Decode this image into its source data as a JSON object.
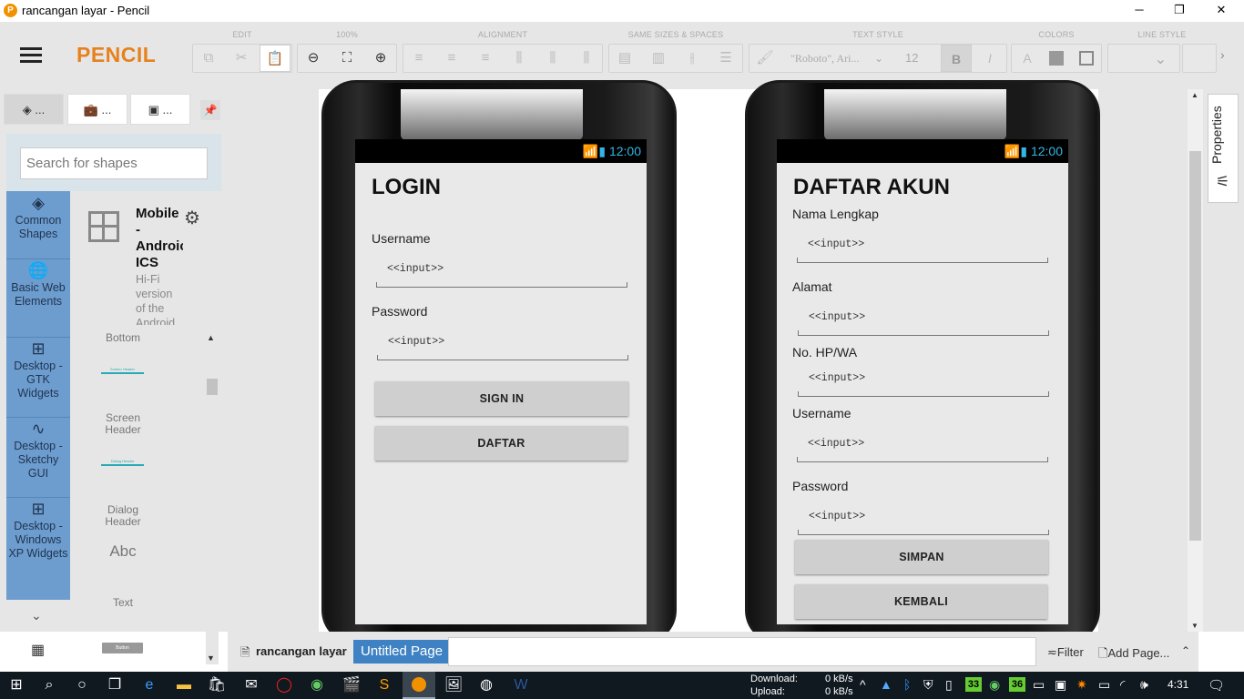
{
  "window": {
    "title": "rancangan layar - Pencil",
    "app_icon": "P",
    "minimize_symbol": "─",
    "maximize_symbol": "❐",
    "close_symbol": "✕"
  },
  "toolbar": {
    "brand": "PENCIL",
    "groups": {
      "edit": "EDIT",
      "zoom": "100%",
      "alignment": "ALIGNMENT",
      "same_sizes": "SAME SIZES & SPACES",
      "text_style": "TEXT STYLE",
      "colors": "COLORS",
      "line_style": "LINE STYLE"
    },
    "font_family": "\"Roboto\", Ari...",
    "font_size": "12",
    "bold": "B",
    "italic": "I",
    "text_color": "A"
  },
  "left_panel": {
    "tabs": [
      "...",
      "...",
      "..."
    ],
    "search_placeholder": "Search for shapes",
    "categories": [
      {
        "label": "Common Shapes",
        "icon": "layers-icon"
      },
      {
        "label": "Basic Web Elements",
        "icon": "globe-icon"
      },
      {
        "label": "Desktop - GTK Widgets",
        "icon": "grid-icon"
      },
      {
        "label": "Desktop - Sketchy GUI",
        "icon": "squiggle-icon"
      },
      {
        "label": "Desktop - Windows XP Widgets",
        "icon": "grid-icon"
      }
    ],
    "collection": {
      "title_lines": [
        "Mobile",
        "-",
        "Androic",
        "ICS"
      ],
      "desc_lines": [
        "Hi-Fi",
        "version",
        "of the",
        "Android"
      ]
    },
    "shapes": [
      "Bottom",
      "Screen Header",
      "Dialog Header",
      "Text"
    ],
    "mini_labels": {
      "screen_header": "Screen Header",
      "dialog_header": "Dialog Header",
      "abc": "Abc",
      "button": "Button"
    }
  },
  "login_screen": {
    "time": "12:00",
    "title": "LOGIN",
    "username_label": "Username",
    "username_input": "<<input>>",
    "password_label": "Password",
    "password_input": "<<input>>",
    "signin_button": "SIGN IN",
    "daftar_button": "DAFTAR"
  },
  "register_screen": {
    "time": "12:00",
    "title": "DAFTAR AKUN",
    "fields": [
      {
        "label": "Nama Lengkap",
        "input": "<<input>>"
      },
      {
        "label": "Alamat",
        "input": "<<input>>"
      },
      {
        "label": "No. HP/WA",
        "input": "<<input>>"
      },
      {
        "label": "Username",
        "input": "<<input>>"
      },
      {
        "label": "Password",
        "input": "<<input>>"
      }
    ],
    "simpan_button": "SIMPAN",
    "kembali_button": "KEMBALI"
  },
  "right_panel": {
    "properties_label": "Properties"
  },
  "page_bar": {
    "document_name": "rancangan layar",
    "page_tab": "Untitled Page",
    "filter_label": "Filter",
    "add_page_label": "Add Page..."
  },
  "taskbar": {
    "download_label": "Download:",
    "download_value": "0 kB/s",
    "upload_label": "Upload:",
    "upload_value": "0 kB/s",
    "badge1": "33",
    "badge2": "36",
    "clock": "4:31"
  }
}
